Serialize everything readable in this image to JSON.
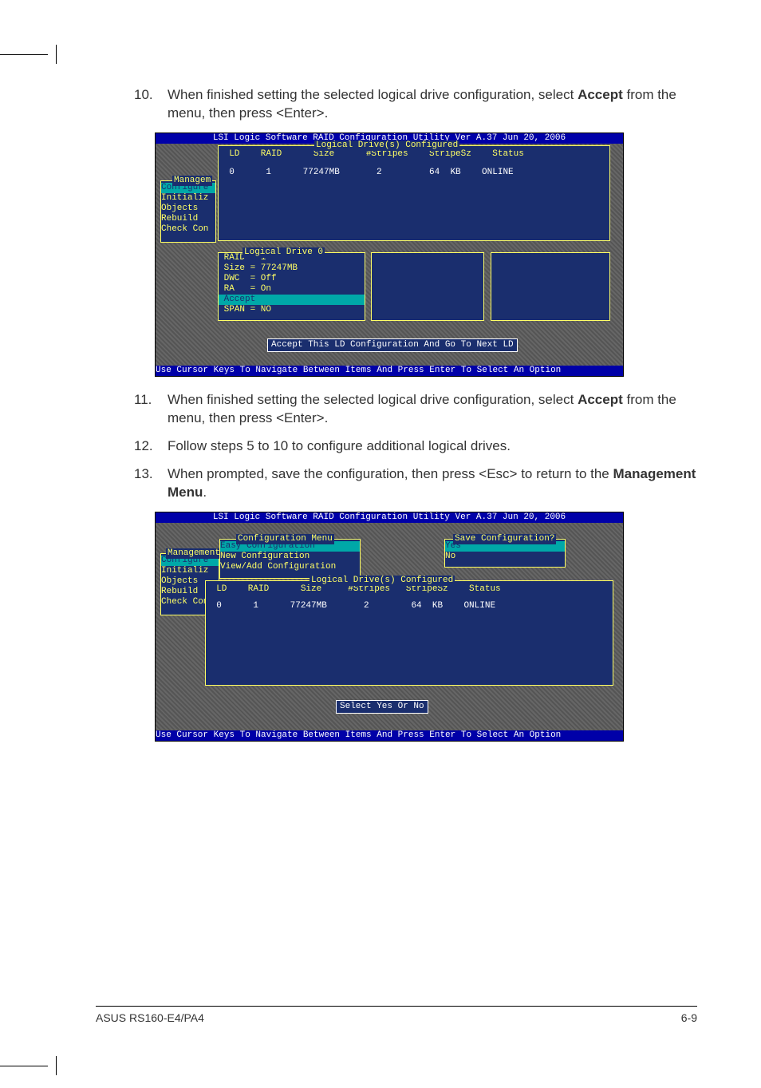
{
  "steps": {
    "s10": {
      "num": "10.",
      "text_a": "When finished setting the selected logical drive configuration, select ",
      "bold": "Accept",
      "text_b": " from the menu, then press <Enter>."
    },
    "s11": {
      "num": "11.",
      "text_a": "When finished setting the selected logical drive configuration, select ",
      "bold": "Accept",
      "text_b": " from the menu, then press <Enter>."
    },
    "s12": {
      "num": "12.",
      "text_a": "Follow steps 5 to 10 to configure additional logical drives.",
      "bold": "",
      "text_b": ""
    },
    "s13": {
      "num": "13.",
      "text_a": "When prompted, save the configuration, then press <Esc> to return to the ",
      "bold": "Management Menu",
      "text_b": "."
    }
  },
  "bios1": {
    "title": "LSI Logic Software RAID Configuration Utility Ver A.37 Jun 20, 2006",
    "table_caption": "Logical Drive(s) Configured",
    "headers": "  LD    RAID      Size      #Stripes    StripeSz    Status",
    "row": "  0      1      77247MB       2         64  KB    ONLINE",
    "mgmt_caption": "Managem",
    "mgmt_items": [
      "Configure",
      "Initializ",
      "Objects",
      "Rebuild",
      "Check Con"
    ],
    "ld0_caption": "Logical Drive 0",
    "ld0_lines": [
      " RAID = 1",
      " Size = 77247MB",
      " DWC  = Off",
      " RA   = On",
      " Accept",
      " SPAN = NO"
    ],
    "accept_msg": "Accept This LD Configuration And Go To Next LD",
    "footer": "Use Cursor Keys To Navigate Between Items And Press Enter To Select An Option"
  },
  "bios2": {
    "title": "LSI Logic Software RAID Configuration Utility Ver A.37 Jun 20, 2006",
    "mgmt_caption": "Management",
    "mgmt_items": [
      "Configure",
      "Initializ",
      "Objects",
      "Rebuild",
      "Check Con"
    ],
    "conf_caption": "Configuration Menu",
    "conf_items": [
      "Easy Configuration",
      "New Configuration",
      "View/Add Configuration"
    ],
    "save_caption": "Save Configuration?",
    "save_items": [
      "Yes",
      "No"
    ],
    "table_caption": "Logical Drive(s) Configured",
    "headers": "  LD    RAID      Size     #Stripes   StripeSz    Status",
    "row": "  0      1      77247MB       2        64  KB    ONLINE",
    "select_msg": "Select Yes Or No",
    "footer": "Use Cursor Keys To Navigate Between Items And Press Enter To Select An Option"
  },
  "page_footer": {
    "left": "ASUS RS160-E4/PA4",
    "right": "6-9"
  }
}
